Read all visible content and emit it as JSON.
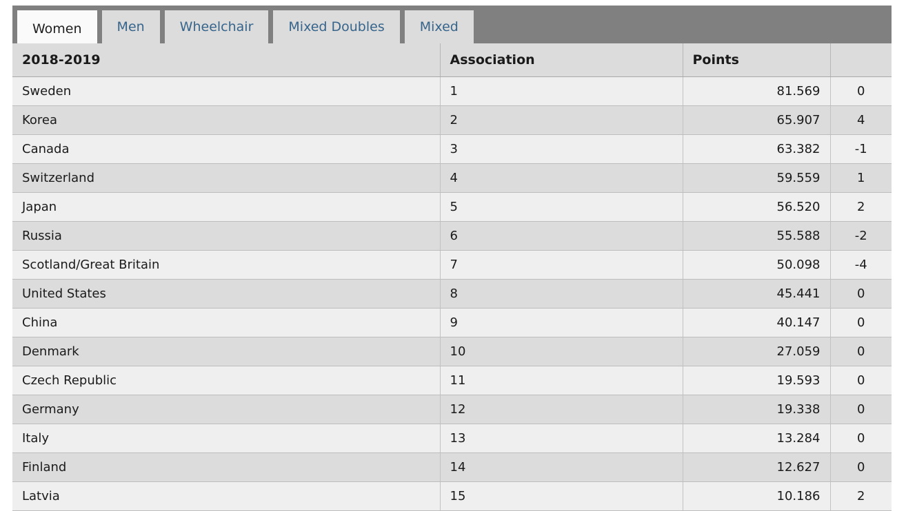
{
  "tabs": [
    {
      "label": "Women",
      "active": true
    },
    {
      "label": "Men",
      "active": false
    },
    {
      "label": "Wheelchair",
      "active": false
    },
    {
      "label": "Mixed Doubles",
      "active": false
    },
    {
      "label": "Mixed",
      "active": false
    }
  ],
  "table": {
    "headers": {
      "season": "2018-2019",
      "association": "Association",
      "points": "Points",
      "change": ""
    },
    "rows": [
      {
        "country": "Sweden",
        "association": "1",
        "points": "81.569",
        "change": "0",
        "change_dir": "zero"
      },
      {
        "country": "Korea",
        "association": "2",
        "points": "65.907",
        "change": "4",
        "change_dir": "pos"
      },
      {
        "country": "Canada",
        "association": "3",
        "points": "63.382",
        "change": "-1",
        "change_dir": "neg"
      },
      {
        "country": "Switzerland",
        "association": "4",
        "points": "59.559",
        "change": "1",
        "change_dir": "pos"
      },
      {
        "country": "Japan",
        "association": "5",
        "points": "56.520",
        "change": "2",
        "change_dir": "pos"
      },
      {
        "country": "Russia",
        "association": "6",
        "points": "55.588",
        "change": "-2",
        "change_dir": "neg"
      },
      {
        "country": "Scotland/Great Britain",
        "association": "7",
        "points": "50.098",
        "change": "-4",
        "change_dir": "neg"
      },
      {
        "country": "United States",
        "association": "8",
        "points": "45.441",
        "change": "0",
        "change_dir": "zero"
      },
      {
        "country": "China",
        "association": "9",
        "points": "40.147",
        "change": "0",
        "change_dir": "zero"
      },
      {
        "country": "Denmark",
        "association": "10",
        "points": "27.059",
        "change": "0",
        "change_dir": "zero"
      },
      {
        "country": "Czech Republic",
        "association": "11",
        "points": "19.593",
        "change": "0",
        "change_dir": "zero"
      },
      {
        "country": "Germany",
        "association": "12",
        "points": "19.338",
        "change": "0",
        "change_dir": "zero"
      },
      {
        "country": "Italy",
        "association": "13",
        "points": "13.284",
        "change": "0",
        "change_dir": "zero"
      },
      {
        "country": "Finland",
        "association": "14",
        "points": "12.627",
        "change": "0",
        "change_dir": "zero"
      },
      {
        "country": "Latvia",
        "association": "15",
        "points": "10.186",
        "change": "2",
        "change_dir": "pos"
      }
    ]
  },
  "colors": {
    "tabbar_background": "#808080",
    "tab_inactive_background": "#dcdcdc",
    "tab_active_background": "#fafafa",
    "tab_link_text": "#36648b",
    "header_background": "#dcdcdc",
    "row_odd_background": "#efefef",
    "row_even_background": "#dcdcdc",
    "change_positive": "#1a7a1a",
    "change_negative": "#e02020",
    "change_zero": "#1a1a1a"
  }
}
